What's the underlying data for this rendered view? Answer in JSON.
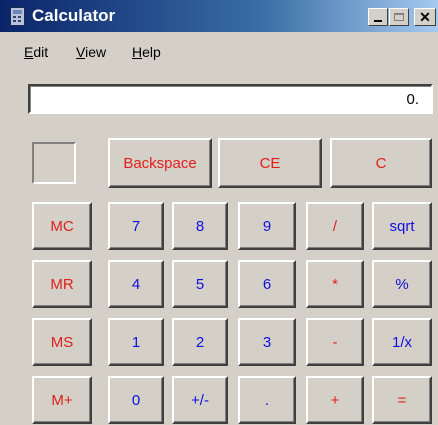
{
  "window": {
    "title": "Calculator"
  },
  "menu": {
    "edit": "dit",
    "view": "iew",
    "help": "elp",
    "edit_mn": "E",
    "view_mn": "V",
    "help_mn": "H"
  },
  "display": {
    "value": "0."
  },
  "top_buttons": [
    "Backspace",
    "CE",
    "C"
  ],
  "memory_buttons": [
    "MC",
    "MR",
    "MS",
    "M+"
  ],
  "keypad": [
    [
      "7",
      "8",
      "9",
      "/",
      "sqrt"
    ],
    [
      "4",
      "5",
      "6",
      "*",
      "%"
    ],
    [
      "1",
      "2",
      "3",
      "-",
      "1/x"
    ],
    [
      "0",
      "+/-",
      ".",
      "+",
      "="
    ]
  ],
  "colors": {
    "title_start": "#0a246a",
    "title_end": "#a6caf0",
    "operator_red": "#e0201c",
    "digit_blue": "#1010e0",
    "face": "#d4d0c8"
  }
}
